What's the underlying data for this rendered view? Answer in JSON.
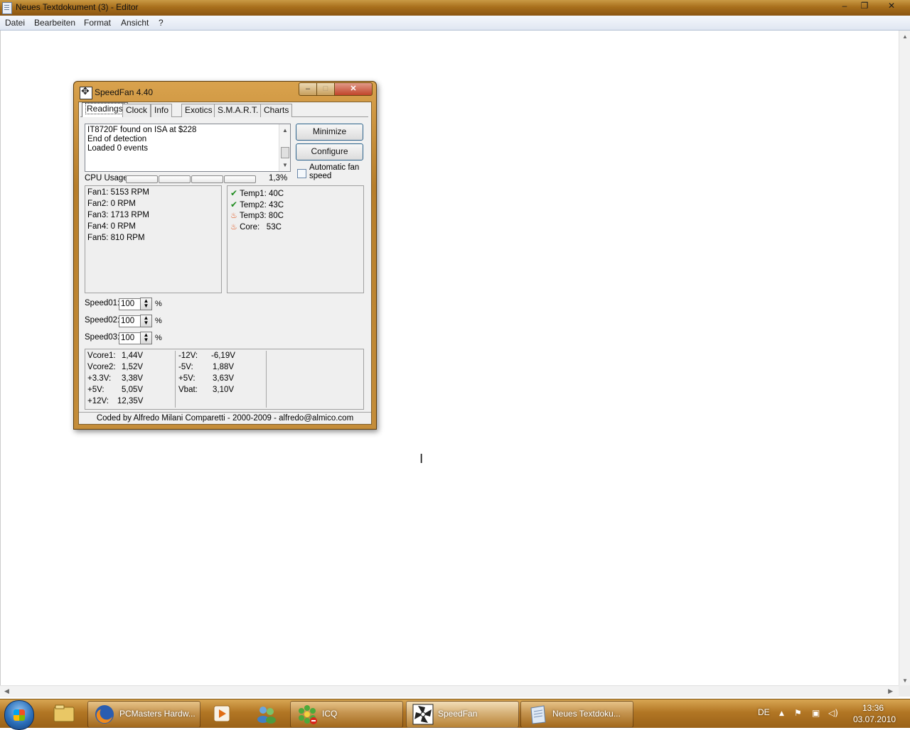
{
  "notepad": {
    "title": "Neues Textdokument (3) - Editor",
    "menu": [
      "Datei",
      "Bearbeiten",
      "Format",
      "Ansicht",
      "?"
    ],
    "controls": {
      "minimize": "–",
      "maximize": "❐",
      "close": "✕"
    }
  },
  "speedfan": {
    "title": "SpeedFan 4.40",
    "controls": {
      "minimize": "–",
      "maximize": "□",
      "close": "✕"
    },
    "tabs": [
      "Readings",
      "Clock",
      "Info",
      "Exotics",
      "S.M.A.R.T.",
      "Charts"
    ],
    "active_tab": "Readings",
    "log": [
      "IT8720F found on ISA at $228",
      "End of detection",
      "Loaded 0 events"
    ],
    "buttons": {
      "minimize": "Minimize",
      "configure": "Configure"
    },
    "auto_fan": {
      "label": "Automatic fan speed",
      "checked": false
    },
    "cpu_usage": {
      "label": "CPU Usage",
      "value": "1,3%",
      "bars": 4
    },
    "fans": [
      {
        "label": "Fan1:",
        "value": "5153 RPM"
      },
      {
        "label": "Fan2:",
        "value": "0 RPM"
      },
      {
        "label": "Fan3:",
        "value": "1713 RPM"
      },
      {
        "label": "Fan4:",
        "value": "0 RPM"
      },
      {
        "label": "Fan5:",
        "value": "810 RPM"
      }
    ],
    "temps": [
      {
        "label": "Temp1:",
        "value": "40C",
        "status": "ok-icon"
      },
      {
        "label": "Temp2:",
        "value": "43C",
        "status": "ok-icon"
      },
      {
        "label": "Temp3:",
        "value": "80C",
        "status": "fire-icon"
      },
      {
        "label": "Core:",
        "value": "53C",
        "status": "fire-icon"
      }
    ],
    "speeds": [
      {
        "label": "Speed01:",
        "value": "100",
        "unit": "%"
      },
      {
        "label": "Speed02:",
        "value": "100",
        "unit": "%"
      },
      {
        "label": "Speed03:",
        "value": "100",
        "unit": "%"
      }
    ],
    "voltages_col1": [
      {
        "label": "Vcore1:",
        "value": "1,44V"
      },
      {
        "label": "Vcore2:",
        "value": "1,52V"
      },
      {
        "label": "+3.3V:",
        "value": "3,38V"
      },
      {
        "label": "+5V:",
        "value": "5,05V"
      },
      {
        "label": "+12V:",
        "value": "12,35V"
      }
    ],
    "voltages_col2": [
      {
        "label": "-12V:",
        "value": "-6,19V"
      },
      {
        "label": "-5V:",
        "value": "1,88V"
      },
      {
        "label": "+5V:",
        "value": "3,63V"
      },
      {
        "label": "Vbat:",
        "value": "3,10V"
      }
    ],
    "footer": "Coded by Alfredo Milani Comparetti - 2000-2009 - alfredo@almico.com"
  },
  "taskbar": {
    "buttons": [
      {
        "label": "PCMasters Hardw...",
        "icon": "firefox-icon"
      },
      {
        "label": "ICQ",
        "icon": "icq-icon"
      },
      {
        "label": "SpeedFan",
        "icon": "speedfan-icon"
      },
      {
        "label": "Neues Textdoku...",
        "icon": "notepad-icon"
      }
    ],
    "pinned": [
      "explorer-icon",
      "media-player-icon",
      "messenger-icon"
    ],
    "tray": {
      "language": "DE",
      "time": "13:36",
      "date": "03.07.2010"
    }
  },
  "colors": {
    "accent": "#b27624",
    "ok": "#1f8c1f",
    "warning": "#e04b10"
  }
}
